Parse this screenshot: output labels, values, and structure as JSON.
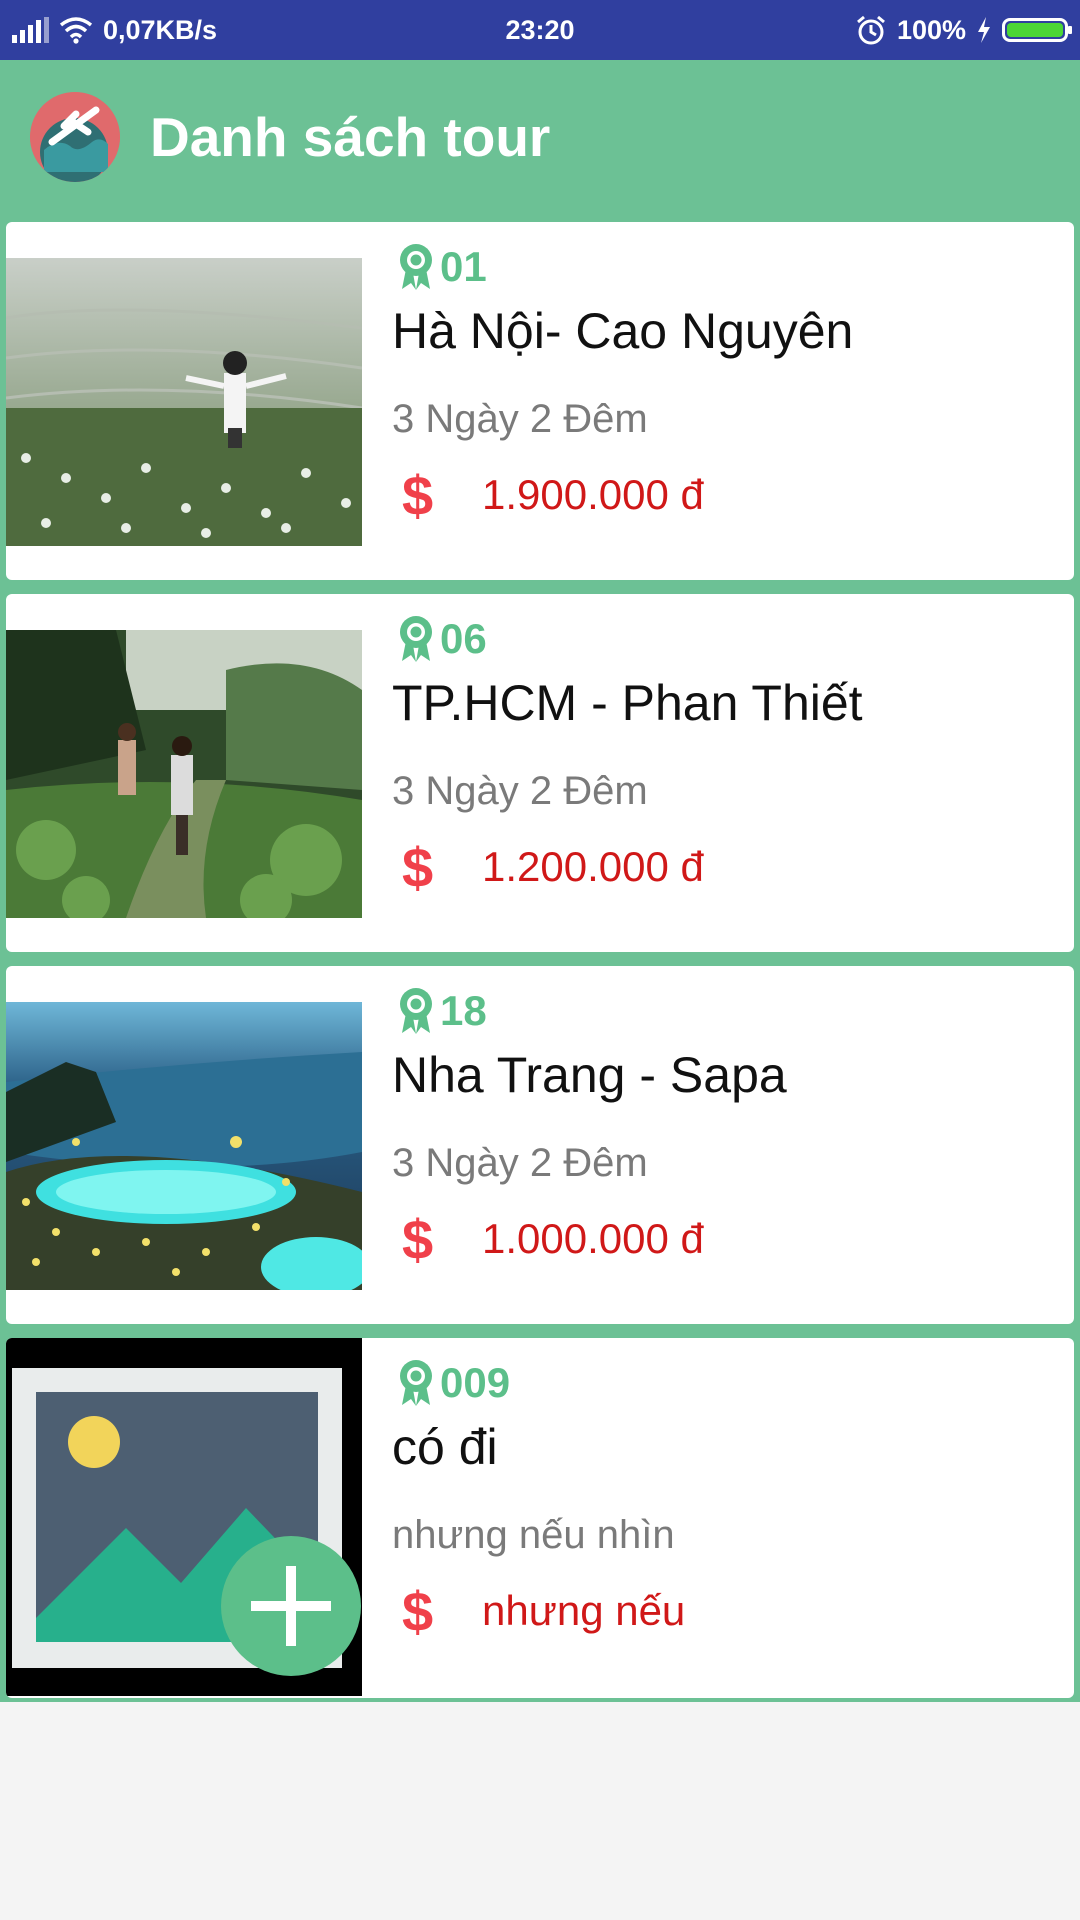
{
  "status_bar": {
    "network_speed": "0,07KB/s",
    "time": "23:20",
    "battery": "100%",
    "icons": [
      "signal-icon",
      "wifi-icon",
      "alarm-icon",
      "charging-icon",
      "battery-icon"
    ]
  },
  "app_bar": {
    "title": "Danh sách tour",
    "logo_icon": "globe-airplane-logo"
  },
  "colors": {
    "status_bar": "#303f9f",
    "app_bar": "#6cc195",
    "code": "#5cbf8a",
    "price": "#d01818",
    "dollar": "#f0404a"
  },
  "tours": [
    {
      "code": "01",
      "name": "Hà Nội- Cao Nguyên",
      "duration": "3 Ngày 2 Đêm",
      "price": "1.900.000 đ",
      "image": "tea-hill-photo"
    },
    {
      "code": "06",
      "name": "TP.HCM - Phan Thiết",
      "duration": "3 Ngày 2 Đêm",
      "price": "1.200.000 đ",
      "image": "forest-path-photo"
    },
    {
      "code": "18",
      "name": "Nha Trang - Sapa",
      "duration": "3 Ngày 2 Đêm",
      "price": "1.000.000 đ",
      "image": "resort-pool-photo"
    },
    {
      "code": "009",
      "name": "có đi",
      "duration": "nhưng nếu nhìn",
      "price": "nhưng nếu",
      "image": "add-image-placeholder"
    }
  ]
}
